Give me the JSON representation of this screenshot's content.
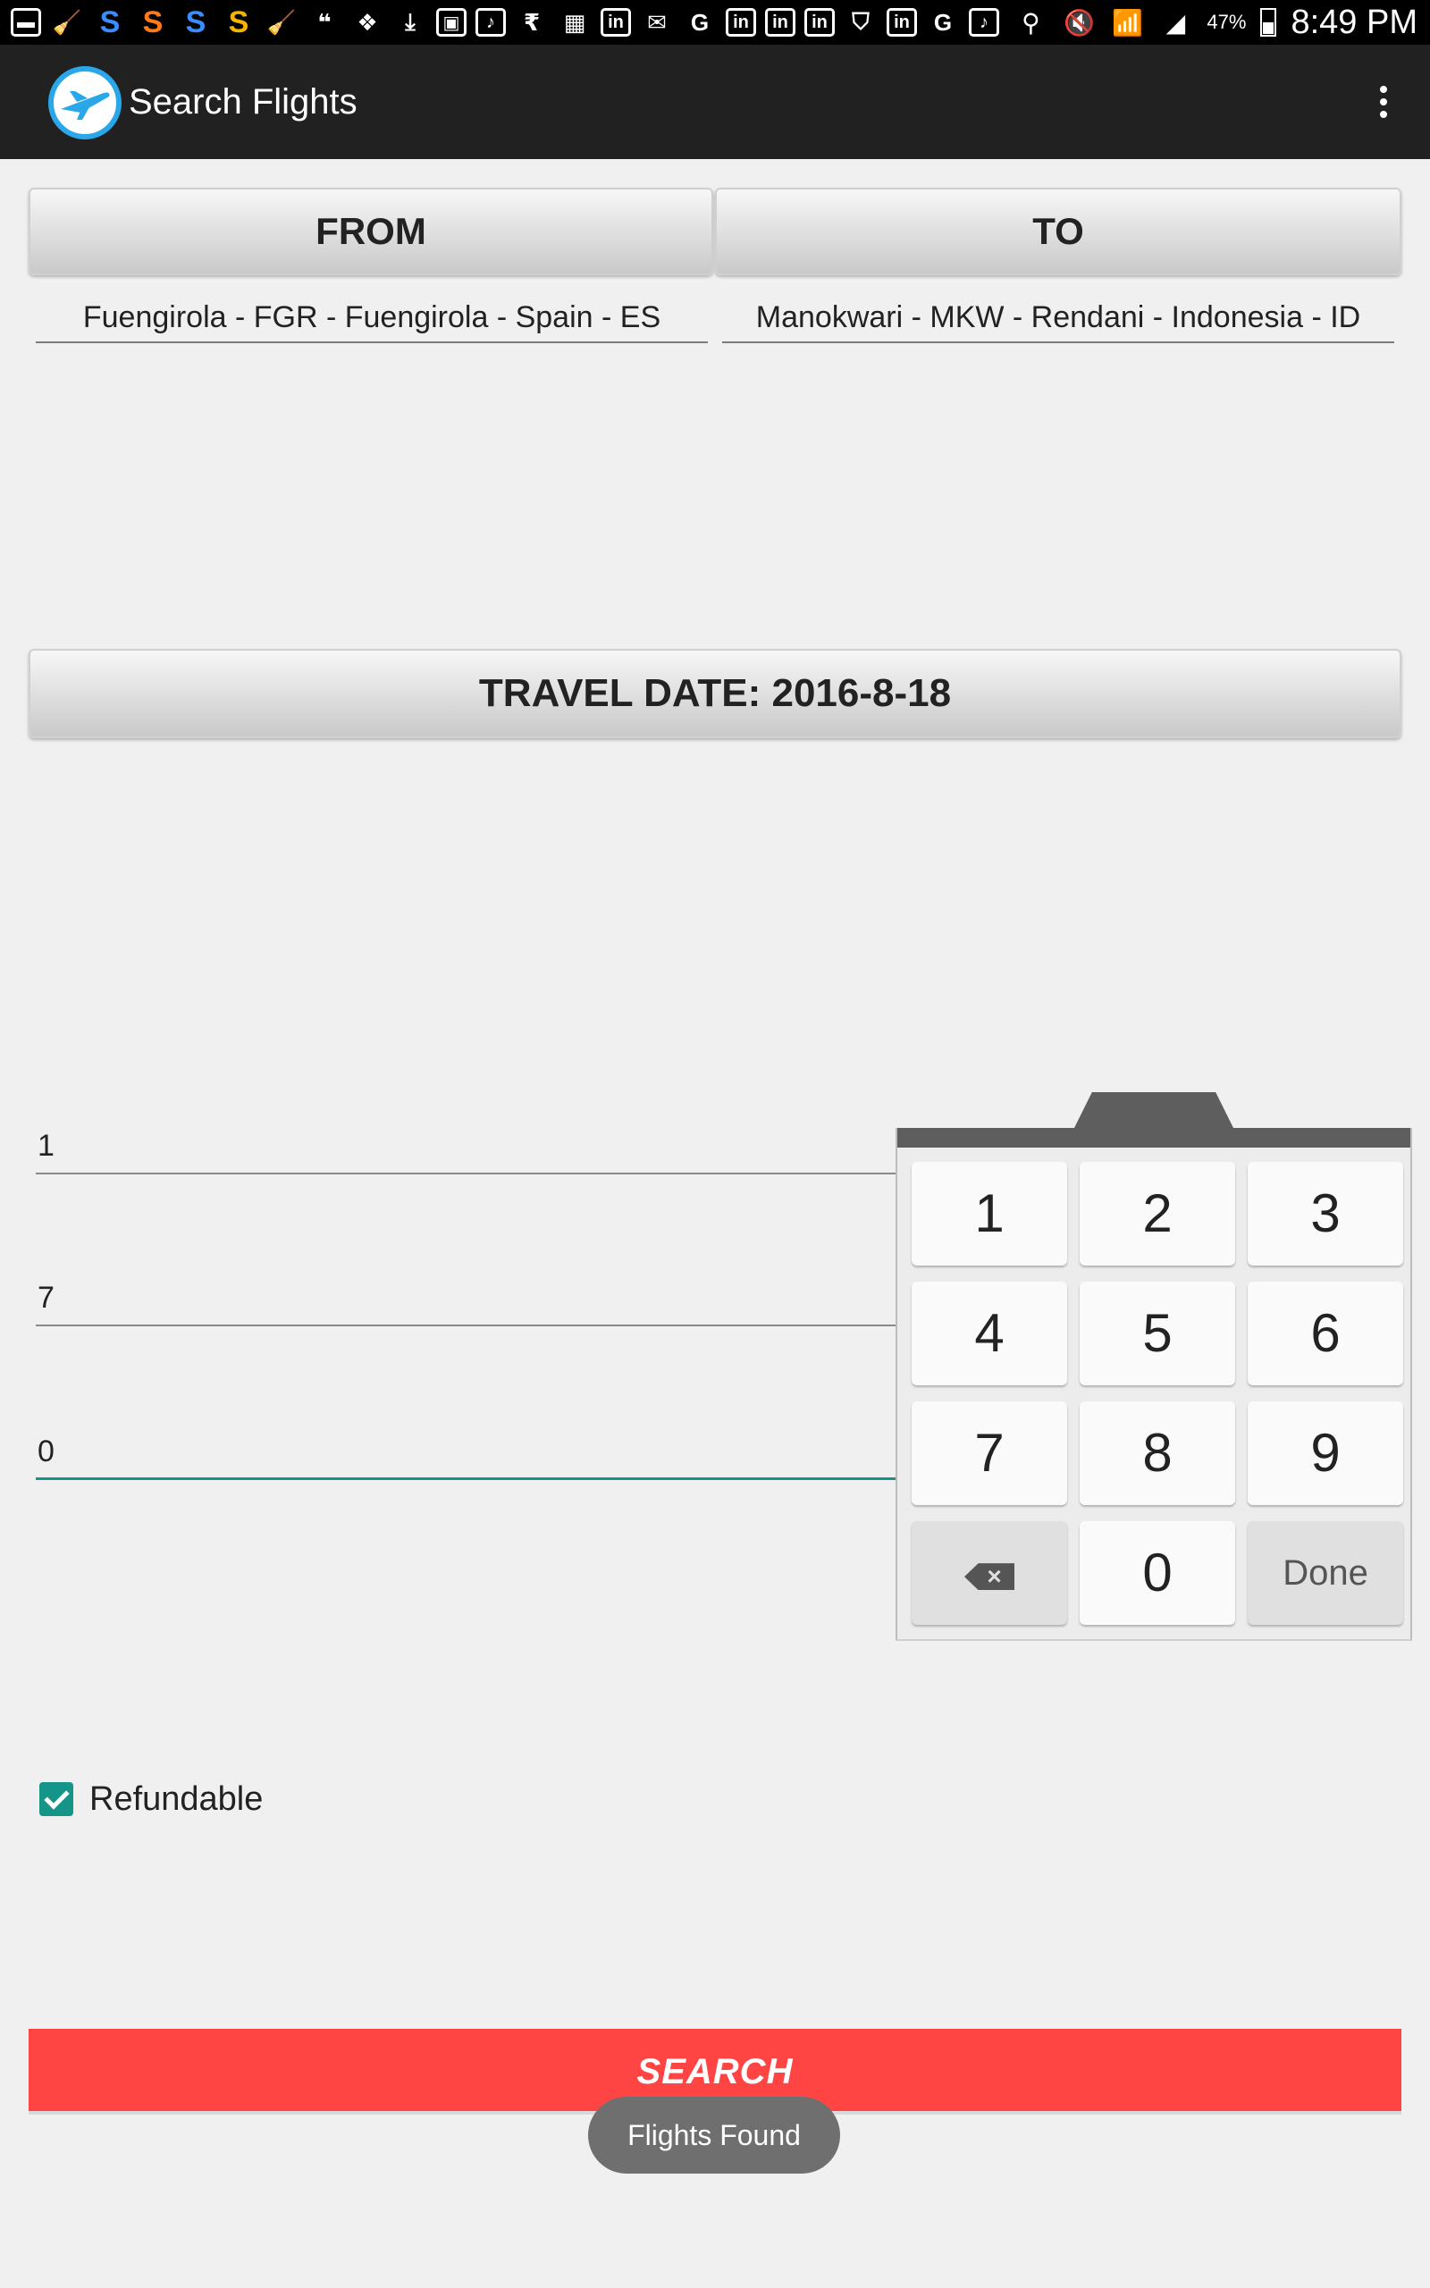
{
  "status_bar": {
    "left_icons": [
      {
        "icon": "chat-icon",
        "glyph": "▬",
        "style": "sq"
      },
      {
        "icon": "cleaner-icon",
        "glyph": "🧹",
        "style": ""
      },
      {
        "icon": "s-app-blue-icon",
        "glyph": "S",
        "style": "blue"
      },
      {
        "icon": "s-app-orange-icon",
        "glyph": "S",
        "style": "orange"
      },
      {
        "icon": "s-app-blue-icon",
        "glyph": "S",
        "style": "blue"
      },
      {
        "icon": "s-app-yellow-icon",
        "glyph": "S",
        "style": "yellow"
      },
      {
        "icon": "cleaner-icon",
        "glyph": "🧹",
        "style": ""
      },
      {
        "icon": "quote-icon",
        "glyph": "❝",
        "style": ""
      },
      {
        "icon": "dropbox-icon",
        "glyph": "❖",
        "style": ""
      },
      {
        "icon": "download-icon",
        "glyph": "⤓",
        "style": ""
      },
      {
        "icon": "image-icon",
        "glyph": "▣",
        "style": "sq"
      },
      {
        "icon": "saavn-icon",
        "glyph": "♪",
        "style": "sq"
      },
      {
        "icon": "rupee-icon",
        "glyph": "₹",
        "style": ""
      },
      {
        "icon": "game-icon",
        "glyph": "▦",
        "style": ""
      },
      {
        "icon": "linkedin-icon",
        "glyph": "in",
        "style": "sq"
      },
      {
        "icon": "mail-icon",
        "glyph": "✉",
        "style": ""
      },
      {
        "icon": "google-icon",
        "glyph": "G",
        "style": ""
      },
      {
        "icon": "linkedin-icon",
        "glyph": "in",
        "style": "sq"
      },
      {
        "icon": "linkedin-icon",
        "glyph": "in",
        "style": "sq"
      },
      {
        "icon": "linkedin-icon",
        "glyph": "in",
        "style": "sq"
      },
      {
        "icon": "vpn-icon",
        "glyph": "⛉",
        "style": ""
      },
      {
        "icon": "linkedin-icon",
        "glyph": "in",
        "style": "sq"
      },
      {
        "icon": "google-icon",
        "glyph": "G",
        "style": ""
      },
      {
        "icon": "saavn-icon",
        "glyph": "♪",
        "style": "sq"
      }
    ],
    "right_icons": [
      {
        "icon": "location-icon",
        "glyph": "⚲"
      },
      {
        "icon": "mute-icon",
        "glyph": "🔇"
      },
      {
        "icon": "wifi-icon",
        "glyph": "📶"
      },
      {
        "icon": "signal-icon",
        "glyph": "◢"
      }
    ],
    "battery_percent": "47%",
    "time": "8:49 PM"
  },
  "toolbar": {
    "title": "Search Flights",
    "logo_icon": "airplane-logo-icon",
    "menu_icon": "overflow-menu-icon"
  },
  "route": {
    "from_label": "FROM",
    "to_label": "TO",
    "from_value": "Fuengirola - FGR - Fuengirola - Spain - ES",
    "to_value": "Manokwari - MKW - Rendani - Indonesia - ID"
  },
  "travel_date_label": "TRAVEL DATE: 2016-8-18",
  "passenger_fields": [
    "1",
    "7",
    "0"
  ],
  "keypad": {
    "keys": [
      "1",
      "2",
      "3",
      "4",
      "5",
      "6",
      "7",
      "8",
      "9",
      "0"
    ],
    "done_label": "Done",
    "backspace_icon": "backspace-icon"
  },
  "refundable": {
    "label": "Refundable",
    "checked": true
  },
  "search_label": "SEARCH",
  "toast": "Flights Found",
  "colors": {
    "accent": "#159488",
    "search_button": "#ff4444",
    "toolbar": "#212121",
    "logo_ring": "#29a7e8"
  }
}
